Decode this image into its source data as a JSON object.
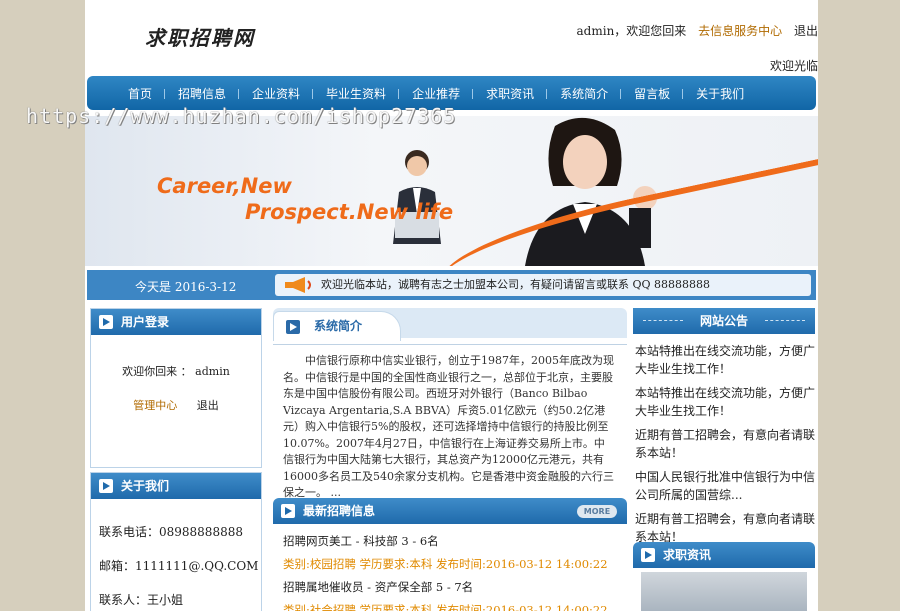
{
  "site": {
    "logo": "求职招聘网"
  },
  "topbar": {
    "user": "admin，欢迎您回来",
    "service_link": "去信息服务中心",
    "logout": "退出",
    "welcome": "欢迎光临"
  },
  "nav": [
    "首页",
    "招聘信息",
    "企业资料",
    "毕业生资料",
    "企业推荐",
    "求职资讯",
    "系统简介",
    "留言板",
    "关于我们"
  ],
  "watermark": "https://www.huzhan.com/ishop27365",
  "banner": {
    "line1": "Career,New",
    "line2": "Prospect.New life"
  },
  "strip": {
    "date": "今天是  2016-3-12",
    "notice": "欢迎光临本站，诚聘有志之士加盟本公司，有疑问请留言或联系 QQ 88888888"
  },
  "login": {
    "title": "用户登录",
    "greeting": "欢迎你回来 ： admin",
    "manage": "管理中心",
    "logout": "退出"
  },
  "about": {
    "title": "关于我们",
    "phone": "联系电话：08988888888",
    "email": "邮箱：1111111@.QQ.COM",
    "contact": "联系人：王小姐"
  },
  "intro": {
    "title": "系统简介",
    "text": "中信银行原称中信实业银行，创立于1987年，2005年底改为现名。中信银行是中国的全国性商业银行之一，总部位于北京，主要股东是中国中信股份有限公司。西班牙对外银行（Banco Bilbao Vizcaya Argentaria,S.A BBVA）斥资5.01亿欧元（约50.2亿港元）购入中信银行5%的股权，还可选择增持中信银行的持股比例至10.07%。2007年4月27日，中信银行在上海证券交易所上市。中信银行为中国大陆第七大银行，其总资产为12000亿元港元，共有16000多名员工及540余家分支机构。它是香港中资金融股的六行三保之一。   ..."
  },
  "latest_jobs": {
    "title": "最新招聘信息",
    "more": "MORE",
    "items": [
      {
        "name": "招聘网页美工 - 科技部     3 - 6名",
        "meta": "类别:校园招聘   学历要求:本科   发布时间:2016-03-12  14:00:22"
      },
      {
        "name": "招聘属地催收员 - 资产保全部     5 - 7名",
        "meta": "类别:社会招聘   学历要求:本科   发布时间:2016-03-12  14:00:22"
      }
    ]
  },
  "announcements": {
    "title": "网站公告",
    "items": [
      "本站特推出在线交流功能，方便广大毕业生找工作！",
      "本站特推出在线交流功能，方便广大毕业生找工作！",
      "近期有普工招聘会，有意向者请联系本站！",
      "中国人民银行批准中信银行为中信公司所属的国营综...",
      "近期有普工招聘会，有意向者请联系本站！"
    ]
  },
  "job_news": {
    "title": "求职资讯"
  },
  "colors": {
    "nav": "#1a6fb0",
    "accent": "#ef6b1a",
    "link": "#b06a00",
    "meta": "#e08a00"
  }
}
